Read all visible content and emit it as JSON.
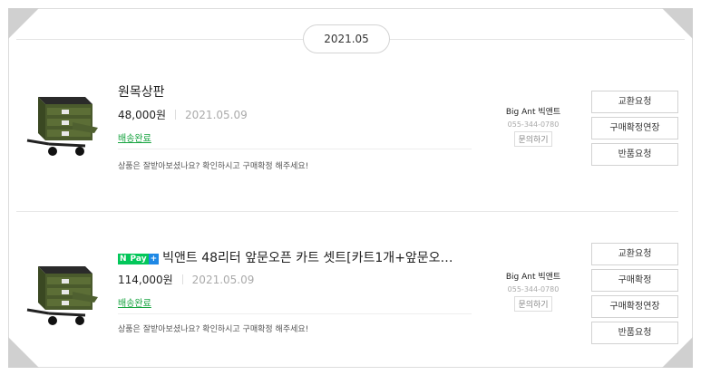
{
  "date_group": "2021.05",
  "orders": [
    {
      "title": "원목상판",
      "naver_pay": false,
      "price": "48,000원",
      "order_date": "2021.05.09",
      "status": "배송완료",
      "message": "상품은 잘받아보셨나요? 확인하시고 구매확정 해주세요!",
      "seller_name": "Big Ant 빅앤트",
      "seller_phone": "055-344-0780",
      "inquiry_label": "문의하기",
      "actions": [
        "교환요청",
        "구매확정연장",
        "반품요청"
      ]
    },
    {
      "title": "빅앤트 48리터 앞문오픈 카트 셋트[카트1개+앞문오…",
      "naver_pay": true,
      "naver_pay_badge": {
        "n": "N",
        "pay": "Pay",
        "plus": "+"
      },
      "price": "114,000원",
      "order_date": "2021.05.09",
      "status": "배송완료",
      "message": "상품은 잘받아보셨나요? 확인하시고 구매확정 해주세요!",
      "seller_name": "Big Ant 빅앤트",
      "seller_phone": "055-344-0780",
      "inquiry_label": "문의하기",
      "actions": [
        "교환요청",
        "구매확정",
        "구매확정연장",
        "반품요청"
      ]
    }
  ]
}
